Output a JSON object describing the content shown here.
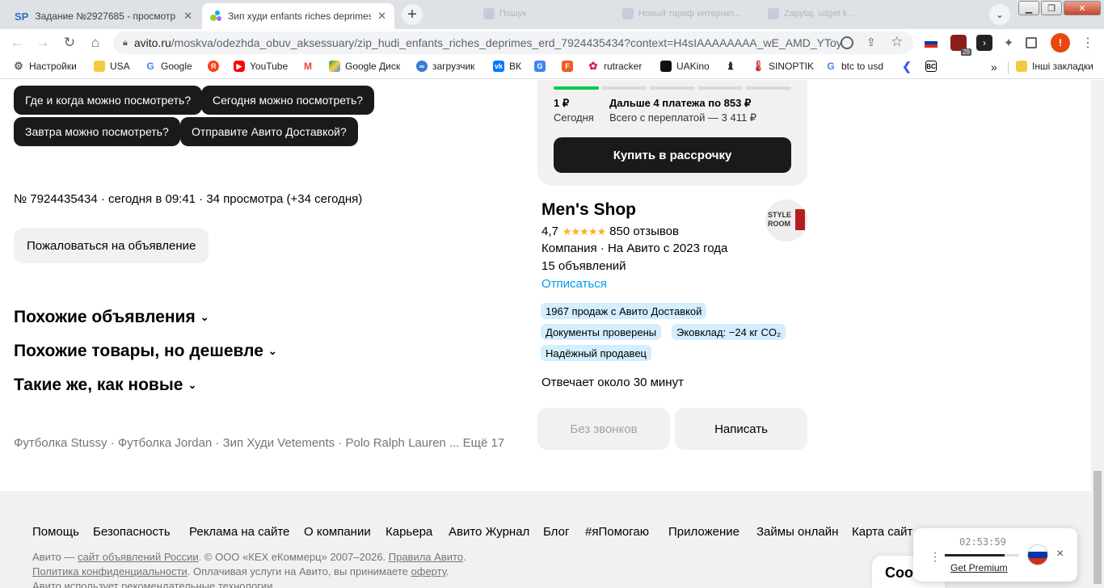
{
  "browser": {
    "tabs": [
      {
        "label": "Задание №2927685 - просмотр",
        "favicon": "SP"
      },
      {
        "label": "Зип худи enfants riches deprimes",
        "favicon": "avito"
      }
    ],
    "ghost_tabs": [
      "Пошук",
      "Новый тариф интернет...",
      "Zapytaj. udget k..."
    ],
    "new_tab": "+",
    "url_domain": "avito.ru",
    "url_path": "/moskva/odezhda_obuv_aksessuary/zip_hudi_enfants_riches_deprimes_erd_7924435434?context=H4sIAAAAAAAA_wE_AMD_YToy...",
    "ext_badge_count": "29",
    "profile_letter": "!"
  },
  "bookmarks": {
    "items": [
      "Настройки",
      "USA",
      "Google",
      "",
      "YouTube",
      "",
      "Google Диск",
      "загрузчик",
      "ВК",
      "",
      "",
      "rutracker",
      "UAKino",
      "",
      "SINOPTIK",
      "btc to usd",
      "",
      ""
    ],
    "more": "»",
    "other_folder": "Інші закладки"
  },
  "questions": [
    "Где и когда можно посмотреть?",
    "Сегодня можно посмотреть?",
    "Завтра можно посмотреть?",
    "Отправите Авито Доставкой?"
  ],
  "listing": {
    "meta": "№ 7924435434 · сегодня в 09:41 · 34 просмотра (+34 сегодня)",
    "report_button": "Пожаловаться на объявление"
  },
  "sections": [
    "Похожие объявления",
    "Похожие товары, но дешевле",
    "Такие же, как новые"
  ],
  "related_links": "Футболка Stussy · Футболка Jordan · Зип Худи Vetements · Polo Ralph Lauren ... Ещё 17",
  "installment": {
    "first_amount": "1 ₽",
    "first_label": "Сегодня",
    "next_title": "Дальше 4 платежа по 853 ₽",
    "next_total": "Всего с переплатой — 3 411 ₽",
    "button": "Купить в рассрочку",
    "progress_filled_segments": 1,
    "progress_total_segments": 5
  },
  "seller": {
    "name": "Men's Shop",
    "rating": "4,7",
    "rating_value": 4.7,
    "stars": "★★★★★",
    "reviews": "850 отзывов",
    "info": "Компания · На Авито с 2023 года",
    "listings": "15 объявлений",
    "unsubscribe": "Отписаться",
    "logo_text_1": "STYLE",
    "logo_text_2": "ROOM",
    "badges": [
      "1967 продаж с Авито Доставкой",
      "Документы проверены",
      "Эковклад: −24 кг CO₂",
      "Надёжный продавец"
    ],
    "response": "Отвечает около 30 минут",
    "no_calls_button": "Без звонков",
    "write_button": "Написать"
  },
  "footer": {
    "links": [
      "Помощь",
      "Безопасность",
      "Реклама на сайте",
      "О компании",
      "Карьера",
      "Авито Журнал",
      "Блог",
      "#яПомогаю",
      "Приложение",
      "Займы онлайн",
      "Карта сайт"
    ],
    "line1_prefix": "Авито — ",
    "line1_link": "сайт объявлений России",
    "line1_mid": ". © ООО «КЕХ еКоммерц» 2007–2026. ",
    "line1_link2": "Правила Авито",
    "line1_end": ".",
    "line2_link": "Политика конфиденциальности",
    "line2_mid": ". Оплачивая услуги на Авито, вы принимаете ",
    "line2_link2": "оферту",
    "line2_end": ".",
    "line3": "Авито использует рекомендательные технологии",
    "cookie_partial": "Coo"
  },
  "vpn_widget": {
    "timer": "02:53:59",
    "premium": "Get Premium",
    "close": "×",
    "menu": "⋮"
  },
  "colors": {
    "chip_bg": "#1a1a1a",
    "green": "#00c853",
    "link_blue": "#0099f7",
    "badge_bg": "#d4edff",
    "footer_bg": "#f2f1f0",
    "star": "#ffb021"
  }
}
